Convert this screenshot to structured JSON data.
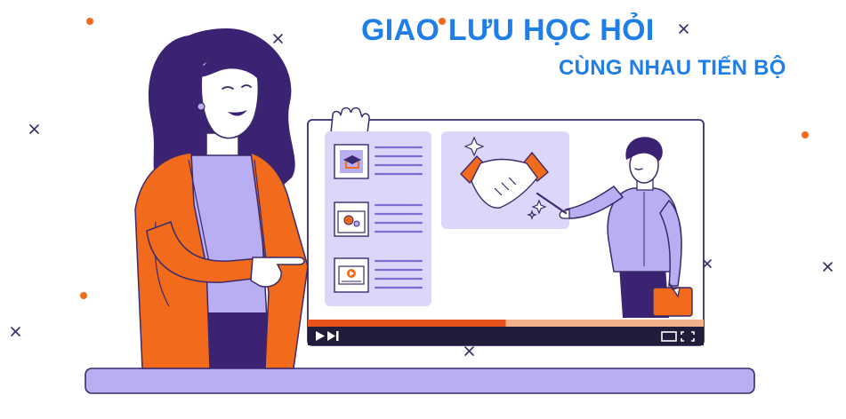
{
  "headline": {
    "line1": "GIAO LƯU HỌC HỎI",
    "line2": "CÙNG NHAU TIẾN BỘ"
  },
  "player": {
    "progress_fraction": 0.5
  },
  "colors": {
    "title_blue": "#1f7ee8",
    "orange": "#f26a1b",
    "purple_dark": "#3b2a6b",
    "lavender": "#b9aef2",
    "lavender_light": "#dcd6fb",
    "player_bar": "#1f1d3a",
    "progress_red": "#e8531b"
  },
  "icons": {
    "course_item_1": "graduation-cap-icon",
    "course_item_2": "settings-gear-icon",
    "course_item_3": "video-play-icon",
    "play": "play-icon",
    "next": "skip-next-icon",
    "screen": "screen-icon",
    "fullscreen": "fullscreen-icon"
  }
}
